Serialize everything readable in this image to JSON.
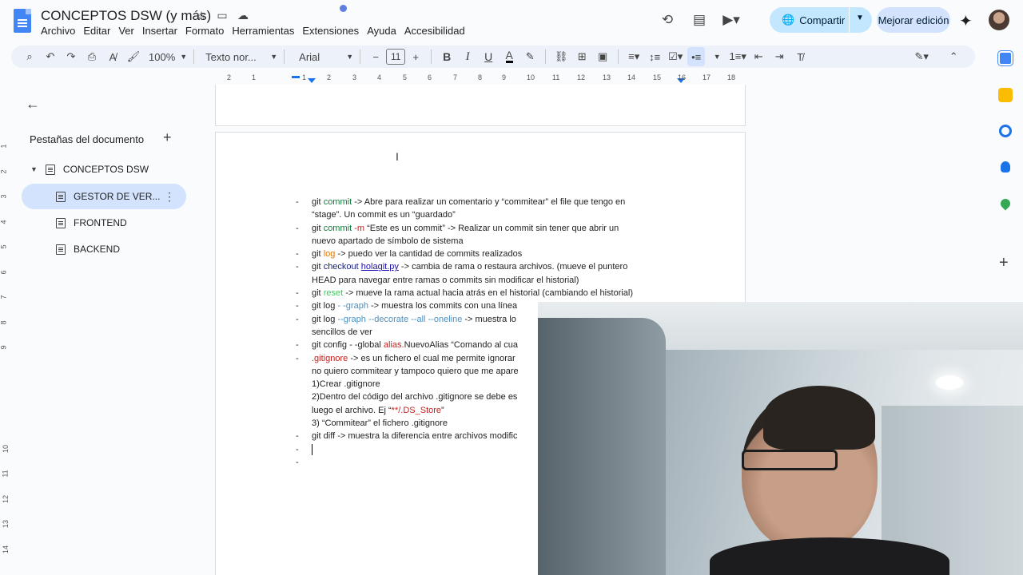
{
  "header": {
    "doc_title": "CONCEPTOS DSW (y más)",
    "menu": [
      "Archivo",
      "Editar",
      "Ver",
      "Insertar",
      "Formato",
      "Herramientas",
      "Extensiones",
      "Ayuda",
      "Accesibilidad"
    ],
    "share_label": "Compartir",
    "improve_label": "Mejorar edición"
  },
  "toolbar": {
    "zoom": "100%",
    "style": "Texto nor...",
    "font": "Arial",
    "font_size": "11"
  },
  "ruler": {
    "ticks": [
      "2",
      "1",
      "1",
      "2",
      "3",
      "4",
      "5",
      "6",
      "7",
      "8",
      "9",
      "10",
      "11",
      "12",
      "13",
      "14",
      "15",
      "16",
      "17",
      "18"
    ],
    "vticks": [
      "1",
      "2",
      "3",
      "4",
      "5",
      "6",
      "7",
      "8",
      "9",
      "10",
      "11",
      "12",
      "13",
      "14"
    ]
  },
  "sidebar": {
    "title": "Pestañas del documento",
    "tabs": [
      {
        "label": "CONCEPTOS DSW"
      },
      {
        "label": "GESTOR DE VER..."
      },
      {
        "label": "FRONTEND"
      },
      {
        "label": "BACKEND"
      }
    ]
  },
  "doc": {
    "l1_a": "git ",
    "l1_b": "commit",
    "l1_c": " -> Abre para realizar un comentario y “commitear” el file que tengo en",
    "l1_d": "“stage”. Un commit es un “guardado”",
    "l2_a": "git ",
    "l2_b": "commit",
    "l2_c": " -m",
    "l2_d": " “Este es un commit” -> Realizar un commit sin tener que abrir un",
    "l2_e": "nuevo apartado de símbolo de sistema",
    "l3_a": "git ",
    "l3_b": "log",
    "l3_c": " -> puedo ver la cantidad de commits realizados",
    "l4_a": "git ",
    "l4_b": "checkout",
    "l4_c": " ",
    "l4_d": "holagit.py",
    "l4_e": " ->  cambia de rama o restaura archivos.  (mueve el puntero",
    "l4_f": "HEAD para navegar entre ramas o commits sin modificar el historial)",
    "l5_a": "git ",
    "l5_b": "reset",
    "l5_c": " -> mueve la rama actual hacia atrás en el historial (cambiando el historial)",
    "l6_a": "git log ",
    "l6_b": "- -graph",
    "l6_c": " -> muestra los commits con una línea",
    "l7_a": "git log ",
    "l7_b": "--graph  --decorate --all --oneline",
    "l7_c": " -> muestra lo",
    "l7_d": "sencillos de ver",
    "l8_a": "git config - -global ",
    "l8_b": "alias.",
    "l8_c": "NuevoAlias “Comando al cua",
    "l9_a": ".gitignore",
    "l9_b": " -> es un fichero el cual me permite ignorar",
    "l9_c": "no quiero commitear y tampoco quiero que me apare",
    "s1": "1)Crear .gitignore",
    "s2": "2)Dentro del código del archivo .gitignore se debe es",
    "s3_a": "luego el archivo. Ej “",
    "s3_b": "**/.DS_Store",
    "s3_c": "”",
    "s4": "3) “Commitear” el fichero .gitignore",
    "l10": "git diff -> muestra la diferencia entre archivos modific",
    "dash": "-"
  }
}
